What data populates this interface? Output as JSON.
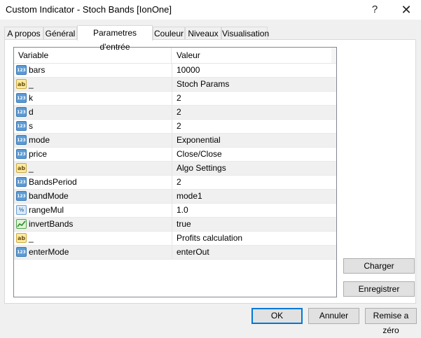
{
  "window": {
    "title": "Custom Indicator - Stoch Bands [IonOne]",
    "help_label": "?",
    "close_label": "✕"
  },
  "tabs": [
    {
      "label": "A propos"
    },
    {
      "label": "Général"
    },
    {
      "label": "Parametres d'entrée"
    },
    {
      "label": "Couleur"
    },
    {
      "label": "Niveaux"
    },
    {
      "label": "Visualisation"
    }
  ],
  "active_tab": "Parametres d'entrée",
  "table": {
    "headers": {
      "variable": "Variable",
      "value": "Valeur"
    },
    "rows": [
      {
        "icon": "int-type-icon",
        "name": "bars",
        "value": "10000"
      },
      {
        "icon": "string-type-icon",
        "name": "_",
        "value": "Stoch Params"
      },
      {
        "icon": "int-type-icon",
        "name": "k",
        "value": "2"
      },
      {
        "icon": "int-type-icon",
        "name": "d",
        "value": "2"
      },
      {
        "icon": "int-type-icon",
        "name": "s",
        "value": "2"
      },
      {
        "icon": "int-type-icon",
        "name": "mode",
        "value": "Exponential"
      },
      {
        "icon": "int-type-icon",
        "name": "price",
        "value": "Close/Close"
      },
      {
        "icon": "string-type-icon",
        "name": "_",
        "value": "Algo Settings"
      },
      {
        "icon": "int-type-icon",
        "name": "BandsPeriod",
        "value": "2"
      },
      {
        "icon": "int-type-icon",
        "name": "bandMode",
        "value": "mode1"
      },
      {
        "icon": "double-type-icon",
        "name": "rangeMul",
        "value": "1.0"
      },
      {
        "icon": "bool-type-icon",
        "name": "invertBands",
        "value": "true"
      },
      {
        "icon": "string-type-icon",
        "name": "_",
        "value": "Profits calculation"
      },
      {
        "icon": "int-type-icon",
        "name": "enterMode",
        "value": "enterOut"
      }
    ]
  },
  "icon_glyphs": {
    "int": "123",
    "string": "ab",
    "double": "½"
  },
  "side_buttons": {
    "load": "Charger",
    "save": "Enregistrer"
  },
  "footer_buttons": {
    "ok": "OK",
    "cancel": "Annuler",
    "reset": "Remise a zéro"
  },
  "colors": {
    "accent": "#0078d7",
    "window_bg": "#f0f0f0"
  }
}
